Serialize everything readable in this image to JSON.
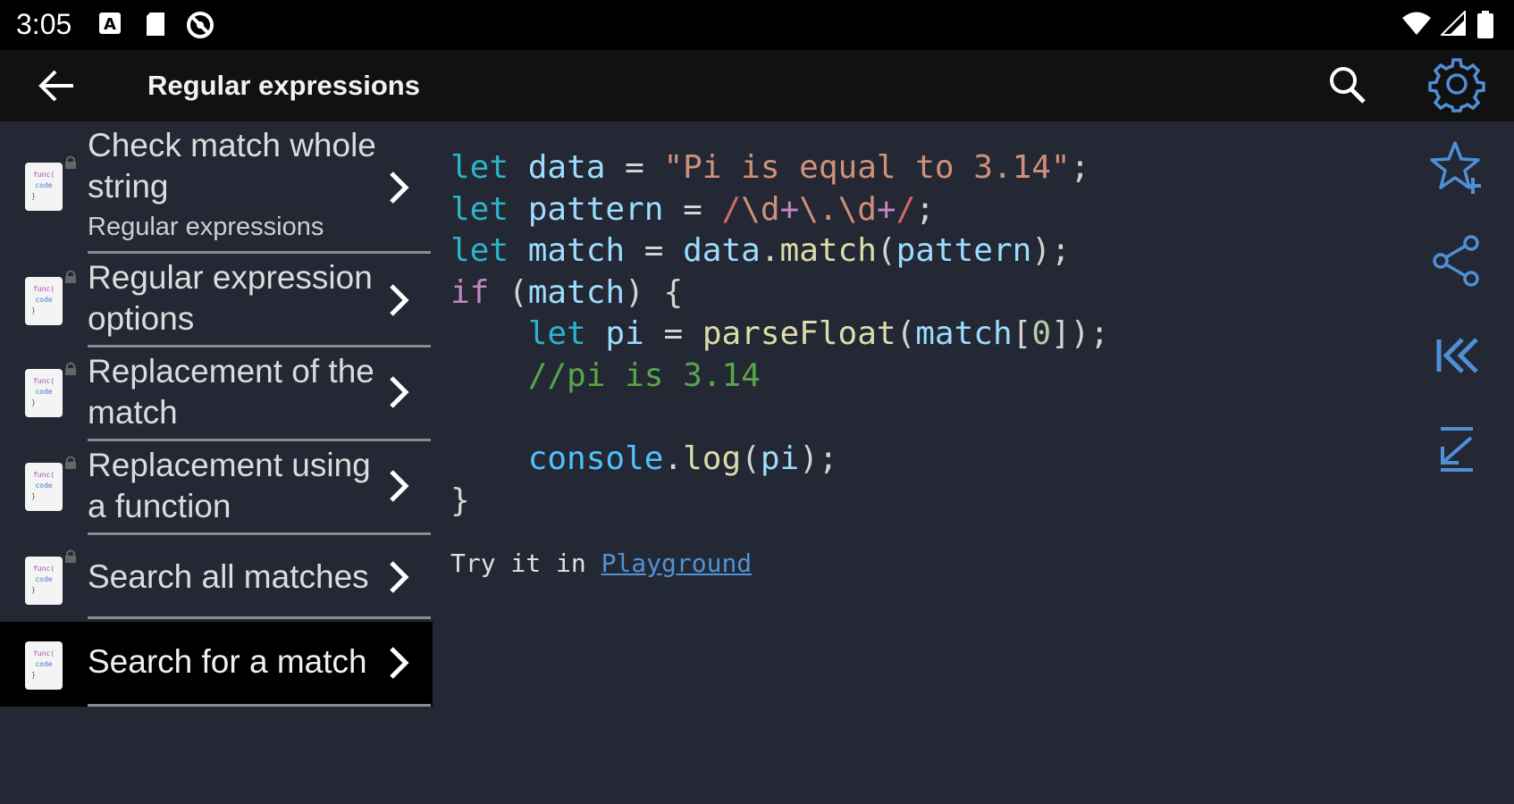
{
  "status_bar": {
    "time": "3:05",
    "icons": [
      "a-notification-icon",
      "sd-card-icon",
      "dnd-icon",
      "wifi-icon",
      "signal-icon",
      "battery-icon"
    ]
  },
  "app_bar": {
    "title": "Regular expressions",
    "back_icon": "arrow-back-icon",
    "search_icon": "search-icon",
    "settings_icon": "gear-icon"
  },
  "list": {
    "items": [
      {
        "title": "Check match whole string",
        "subtitle": "Regular expressions",
        "selected": false
      },
      {
        "title": "Regular expression options",
        "subtitle": "",
        "selected": false
      },
      {
        "title": "Replacement of the match",
        "subtitle": "",
        "selected": false
      },
      {
        "title": "Replacement using a function",
        "subtitle": "",
        "selected": false
      },
      {
        "title": "Search all matches",
        "subtitle": "",
        "selected": false
      },
      {
        "title": "Search for a match",
        "subtitle": "",
        "selected": true
      }
    ]
  },
  "code": {
    "lines": [
      "let data = \"Pi is equal to 3.14\";",
      "let pattern = /\\d+\\.\\d+/;",
      "let match = data.match(pattern);",
      "if (match) {",
      "    let pi = parseFloat(match[0]);",
      "    //pi is 3.14",
      "",
      "    console.log(pi);",
      "}"
    ]
  },
  "try_it": {
    "prefix": "Try it in ",
    "link": "Playground"
  },
  "actions": {
    "icons": [
      "star-add-icon",
      "share-icon",
      "first-page-icon",
      "scroll-to-bottom-icon"
    ]
  },
  "colors": {
    "background": "#242834",
    "app_bar": "#111111",
    "accent": "#4f8fd6",
    "keyword": "#2bb3c8"
  }
}
